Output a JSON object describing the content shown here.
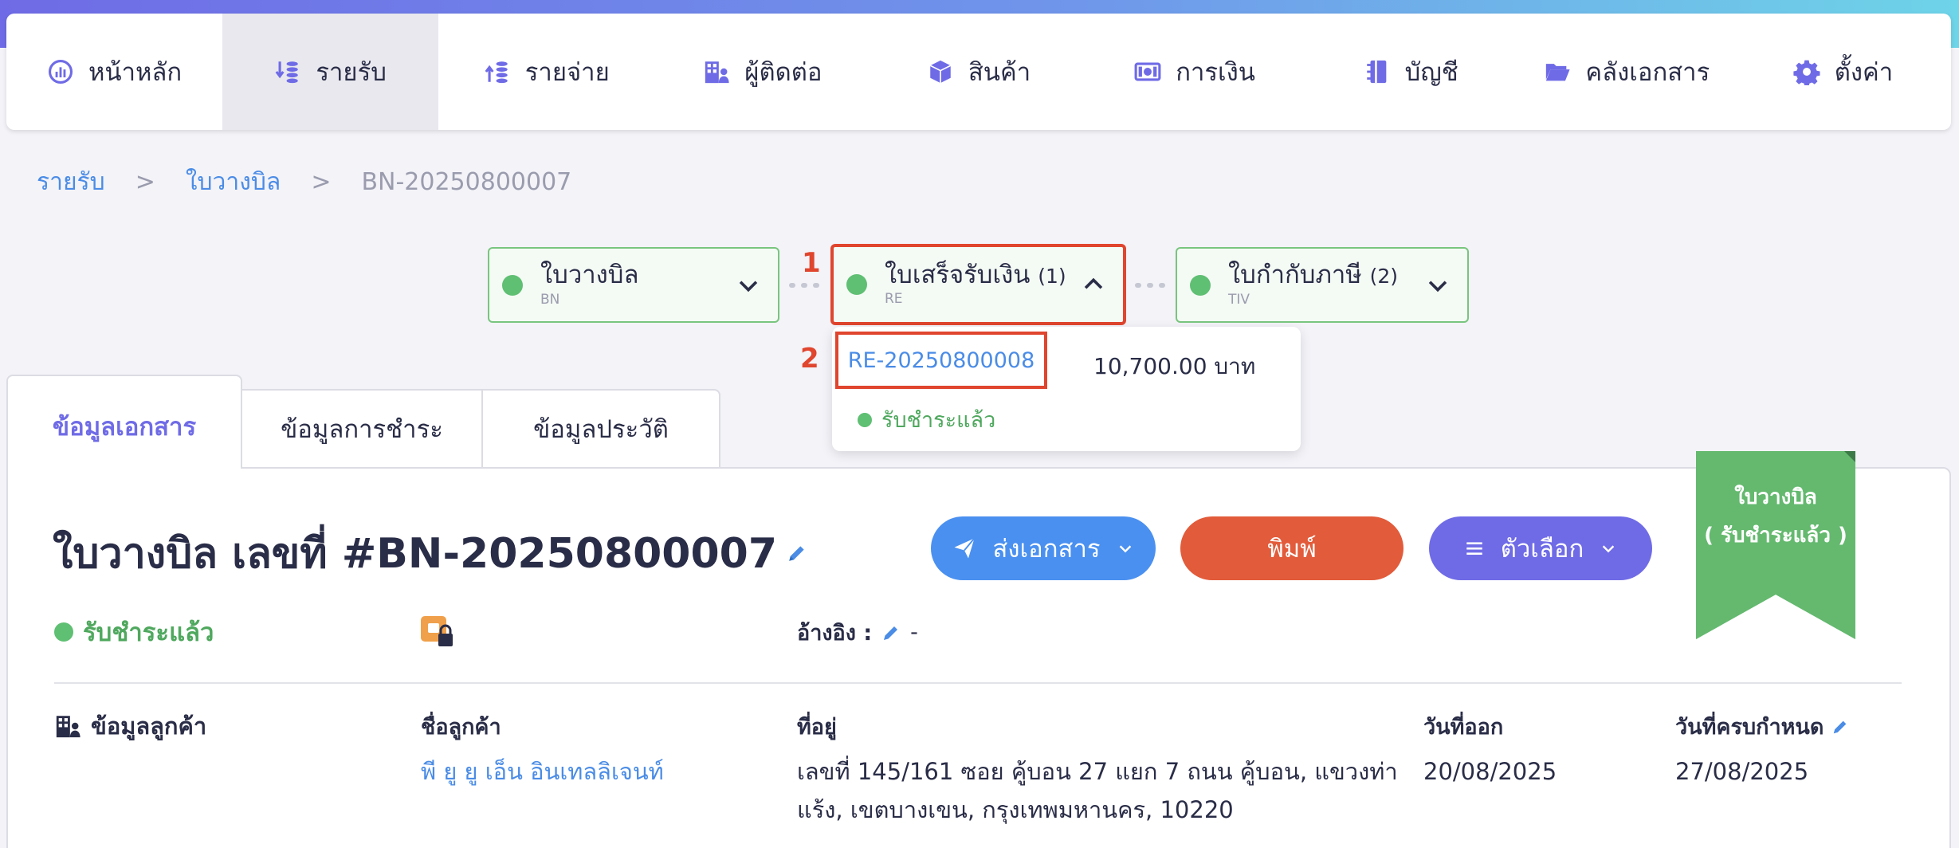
{
  "nav": {
    "items": [
      {
        "label": "หน้าหลัก",
        "icon": "dashboard-icon"
      },
      {
        "label": "รายรับ",
        "icon": "income-icon",
        "active": true
      },
      {
        "label": "รายจ่าย",
        "icon": "expense-icon"
      },
      {
        "label": "ผู้ติดต่อ",
        "icon": "contacts-icon"
      },
      {
        "label": "สินค้า",
        "icon": "box-icon"
      },
      {
        "label": "การเงิน",
        "icon": "money-icon"
      },
      {
        "label": "บัญชี",
        "icon": "ledger-icon"
      },
      {
        "label": "คลังเอกสาร",
        "icon": "folder-icon"
      },
      {
        "label": "ตั้งค่า",
        "icon": "gear-icon"
      }
    ]
  },
  "breadcrumb": {
    "level1": "รายรับ",
    "level2": "ใบวางบิล",
    "current": "BN-20250800007",
    "separator": ">"
  },
  "flow": {
    "billing": {
      "label": "ใบวางบิล",
      "code": "BN"
    },
    "receipt": {
      "label": "ใบเสร็จรับเงิน",
      "count": "(1)",
      "code": "RE"
    },
    "tax_invoice": {
      "label": "ใบกำกับภาษี",
      "count": "(2)",
      "code": "TIV"
    }
  },
  "annotations": {
    "first": "1",
    "second": "2"
  },
  "receipt_dropdown": {
    "doc_id": "RE-20250800008",
    "amount": "10,700.00 บาท",
    "status": "รับชำระแล้ว"
  },
  "tabs": {
    "doc_info": "ข้อมูลเอกสาร",
    "payment_info": "ข้อมูลการชำระ",
    "history": "ข้อมูลประวัติ"
  },
  "document": {
    "title": "ใบวางบิล เลขที่ #BN-20250800007",
    "status": "รับชำระแล้ว",
    "reference_label": "อ้างอิง :",
    "reference_value": "-"
  },
  "buttons": {
    "send": "ส่งเอกสาร",
    "print": "พิมพ์",
    "options": "ตัวเลือก"
  },
  "ribbon": {
    "line1": "ใบวางบิล",
    "line2": "( รับชำระแล้ว )"
  },
  "customer": {
    "section_title": "ข้อมูลลูกค้า",
    "name_label": "ชื่อลูกค้า",
    "name": "พี ยู ยู เอ็น อินเทลลิเจนท์",
    "address_label": "ที่อยู่",
    "address_line1": "เลขที่ 145/161 ซอย คู้บอน 27 แยก 7 ถนน คู้บอน, แขวงท่า",
    "address_line2": "แร้ง, เขตบางเขน, กรุงเทพมหานคร, 10220",
    "issue_date_label": "วันที่ออก",
    "issue_date": "20/08/2025",
    "due_date_label": "วันที่ครบกำหนด",
    "due_date": "27/08/2025"
  },
  "colors": {
    "primary": "#6f6be6",
    "link": "#4a8ce6",
    "success": "#5fbf73",
    "print": "#e25b3a",
    "send": "#4a90f0",
    "highlight": "#e0452e"
  }
}
